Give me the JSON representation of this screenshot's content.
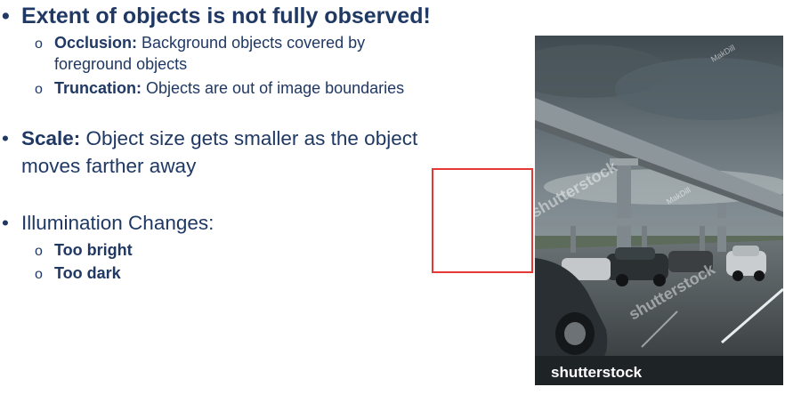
{
  "bullets": {
    "extent": {
      "heading": "Extent of objects is not fully observed!",
      "occlusion": {
        "term": "Occlusion:",
        "text1": " Background objects covered by",
        "text2": "foreground objects"
      },
      "truncation": {
        "term": "Truncation:",
        "text": " Objects are out of image boundaries"
      }
    },
    "scale": {
      "term": "Scale:",
      "text1": " Object size gets smaller as the object",
      "text2": "moves farther away"
    },
    "illumination": {
      "heading": "Illumination Changes:",
      "items": [
        "Too bright",
        "Too dark"
      ]
    }
  },
  "image": {
    "watermark_brand": "shutterstock",
    "watermark_author": "MakDill",
    "palette": {
      "sky": "#6f7d83",
      "road": "#4b5255",
      "overpass": "#8d969a",
      "annotation": "#e53935",
      "text": "#1f3864"
    }
  }
}
